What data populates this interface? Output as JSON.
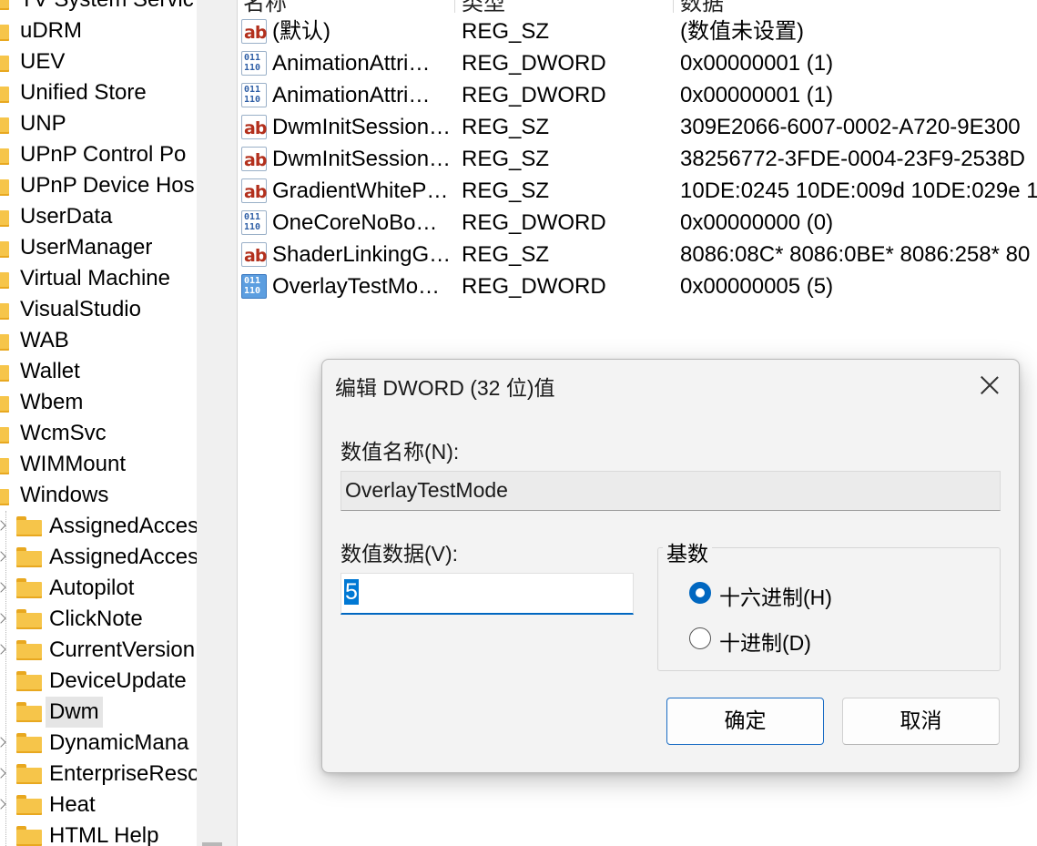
{
  "tree": {
    "items": [
      {
        "label": "TV System Servic",
        "level": 0
      },
      {
        "label": "uDRM",
        "level": 0
      },
      {
        "label": "UEV",
        "level": 0
      },
      {
        "label": "Unified Store",
        "level": 0
      },
      {
        "label": "UNP",
        "level": 0
      },
      {
        "label": "UPnP Control Po",
        "level": 0
      },
      {
        "label": "UPnP Device Hos",
        "level": 0
      },
      {
        "label": "UserData",
        "level": 0
      },
      {
        "label": "UserManager",
        "level": 0
      },
      {
        "label": "Virtual Machine",
        "level": 0
      },
      {
        "label": "VisualStudio",
        "level": 0
      },
      {
        "label": "WAB",
        "level": 0
      },
      {
        "label": "Wallet",
        "level": 0
      },
      {
        "label": "Wbem",
        "level": 0
      },
      {
        "label": "WcmSvc",
        "level": 0
      },
      {
        "label": "WIMMount",
        "level": 0
      },
      {
        "label": "Windows",
        "level": 0
      },
      {
        "label": "AssignedAcces",
        "level": 1,
        "expandable": true
      },
      {
        "label": "AssignedAcces",
        "level": 1,
        "expandable": true
      },
      {
        "label": "Autopilot",
        "level": 1,
        "expandable": true
      },
      {
        "label": "ClickNote",
        "level": 1,
        "expandable": true
      },
      {
        "label": "CurrentVersion",
        "level": 1,
        "expandable": true
      },
      {
        "label": "DeviceUpdate",
        "level": 1,
        "expandable": false
      },
      {
        "label": "Dwm",
        "level": 1,
        "expandable": false,
        "selected": true
      },
      {
        "label": "DynamicMana",
        "level": 1,
        "expandable": true
      },
      {
        "label": "EnterpriseReso",
        "level": 1,
        "expandable": true
      },
      {
        "label": "Heat",
        "level": 1,
        "expandable": true
      },
      {
        "label": "HTML Help",
        "level": 1,
        "expandable": false
      }
    ]
  },
  "values_list": {
    "headers": {
      "name": "名称",
      "type": "类型",
      "data": "数据"
    },
    "rows": [
      {
        "icon": "string-value-icon",
        "name": "(默认)",
        "type": "REG_SZ",
        "data": "(数值未设置)"
      },
      {
        "icon": "dword-value-icon",
        "name": "AnimationAttri…",
        "type": "REG_DWORD",
        "data": "0x00000001 (1)"
      },
      {
        "icon": "dword-value-icon",
        "name": "AnimationAttri…",
        "type": "REG_DWORD",
        "data": "0x00000001 (1)"
      },
      {
        "icon": "string-value-icon",
        "name": "DwmInitSession…",
        "type": "REG_SZ",
        "data": "309E2066-6007-0002-A720-9E300"
      },
      {
        "icon": "string-value-icon",
        "name": "DwmInitSession…",
        "type": "REG_SZ",
        "data": "38256772-3FDE-0004-23F9-2538D"
      },
      {
        "icon": "string-value-icon",
        "name": "GradientWhiteP…",
        "type": "REG_SZ",
        "data": "10DE:0245 10DE:009d 10DE:029e 1"
      },
      {
        "icon": "dword-value-icon",
        "name": "OneCoreNoBo…",
        "type": "REG_DWORD",
        "data": "0x00000000 (0)"
      },
      {
        "icon": "string-value-icon",
        "name": "ShaderLinkingG…",
        "type": "REG_SZ",
        "data": "8086:08C* 8086:0BE* 8086:258* 80"
      },
      {
        "icon": "dword-value-icon",
        "name": "OverlayTestMo…",
        "type": "REG_DWORD",
        "data": "0x00000005 (5)",
        "selected": true
      }
    ],
    "icon_text": {
      "sz": "ab",
      "dword": "011\n110"
    }
  },
  "dialog": {
    "title": "编辑 DWORD (32 位)值",
    "name_label": "数值名称(N):",
    "name_value": "OverlayTestMode",
    "data_label": "数值数据(V):",
    "data_value": "5",
    "base_label": "基数",
    "radio_hex": {
      "label": "十六进制(H)",
      "checked": true
    },
    "radio_dec": {
      "label": "十进制(D)",
      "checked": false
    },
    "ok_label": "确定",
    "cancel_label": "取消"
  },
  "colors": {
    "accent": "#0067c0",
    "folder": "#f6c54a",
    "selection_text_bg": "#0078d4"
  }
}
